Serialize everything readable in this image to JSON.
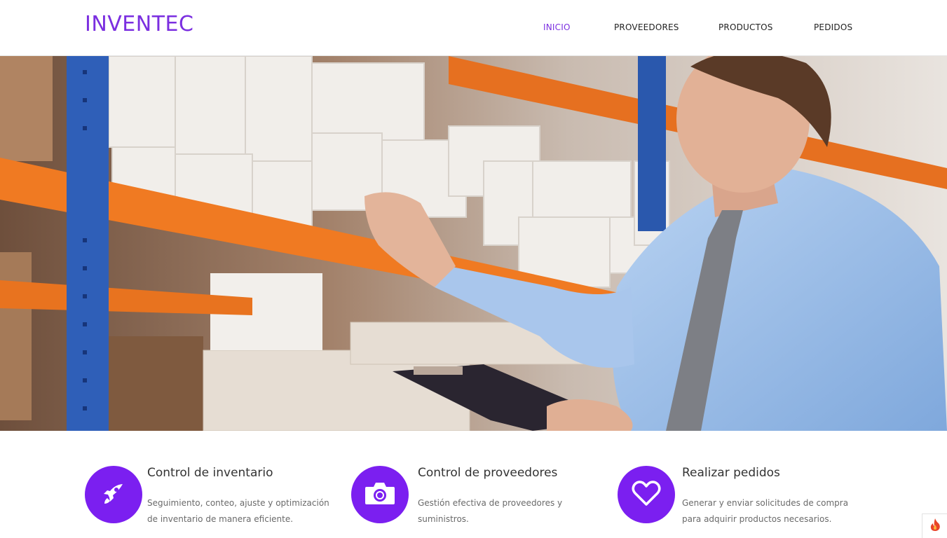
{
  "brand": {
    "name": "INVENTEC",
    "color": "#7b2fe0"
  },
  "nav": {
    "items": [
      {
        "label": "INICIO",
        "active": true
      },
      {
        "label": "PROVEEDORES",
        "active": false
      },
      {
        "label": "PRODUCTOS",
        "active": false
      },
      {
        "label": "PEDIDOS",
        "active": false
      }
    ],
    "active_color": "#7b2fe0"
  },
  "hero": {
    "image": "warehouse-worker-with-clipboard-photo"
  },
  "features": [
    {
      "icon": "rocket-icon",
      "title": "Control de inventario",
      "description": "Seguimiento, conteo, ajuste y optimización de inventario de manera eficiente."
    },
    {
      "icon": "camera-icon",
      "title": "Control de proveedores",
      "description": "Gestión efectiva de proveedores y suministros."
    },
    {
      "icon": "heart-icon",
      "title": "Realizar pedidos",
      "description": "Generar y enviar solicitudes de compra para adquirir productos necesarios."
    }
  ],
  "colors": {
    "accent": "#7b2fe0",
    "icon_circle": "#7b1ff0"
  },
  "corner_widget": {
    "icon": "flame-icon"
  }
}
